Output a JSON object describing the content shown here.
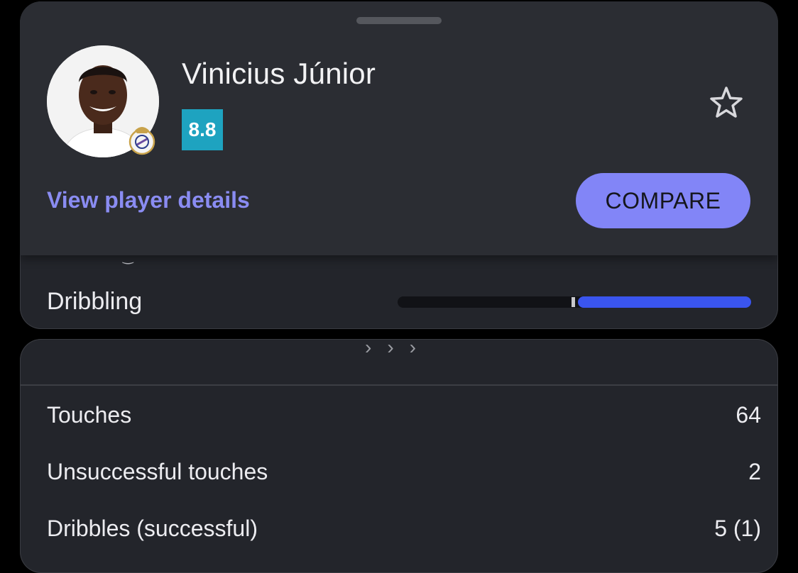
{
  "player": {
    "name": "Vinicius Júnior",
    "rating": "8.8",
    "avatar": "player-photo",
    "club_badge": "real-madrid-crest"
  },
  "actions": {
    "details_link": "View player details",
    "compare_label": "COMPARE",
    "favorite_icon": "star-outline-icon"
  },
  "comparison": {
    "label": "Dribbling",
    "bar_fraction": 0.49
  },
  "stats": [
    {
      "label": "Touches",
      "value": "64"
    },
    {
      "label": "Unsuccessful touches",
      "value": "2"
    },
    {
      "label": "Dribbles (successful)",
      "value": "5 (1)"
    }
  ],
  "colors": {
    "accent": "#8285f7",
    "rating_bg": "#1ea3c0",
    "bar_fill": "#3a55ee"
  }
}
